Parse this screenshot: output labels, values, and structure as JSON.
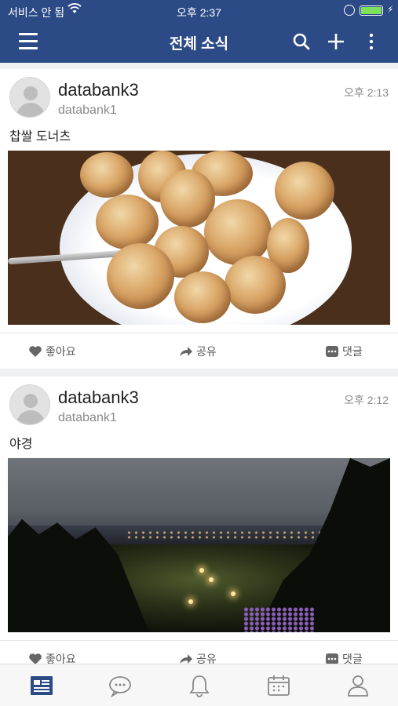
{
  "status_bar": {
    "carrier": "서비스 안 됨",
    "time": "오후 2:37",
    "battery_color": "#7ee35a"
  },
  "header": {
    "title": "전체 소식",
    "icons": [
      "menu-icon",
      "search-icon",
      "plus-icon",
      "more-vertical-icon"
    ],
    "background": "#2b4a86"
  },
  "posts": [
    {
      "user": "databank3",
      "sub": "databank1",
      "time": "오후 2:13",
      "text": "찹쌀 도너츠",
      "photo": "sugar-donuts-photo",
      "actions": {
        "like": "좋아요",
        "share": "공유",
        "comment": "댓글"
      }
    },
    {
      "user": "databank3",
      "sub": "databank1",
      "time": "오후 2:12",
      "text": "야경",
      "photo": "night-view-photo",
      "actions": {
        "like": "좋아요",
        "share": "공유",
        "comment": "댓글"
      }
    }
  ],
  "tabbar": {
    "tabs": [
      "news-feed-icon",
      "chat-icon",
      "bell-icon",
      "calendar-icon",
      "profile-icon"
    ],
    "active_index": 0,
    "active_color": "#2b4a86"
  }
}
